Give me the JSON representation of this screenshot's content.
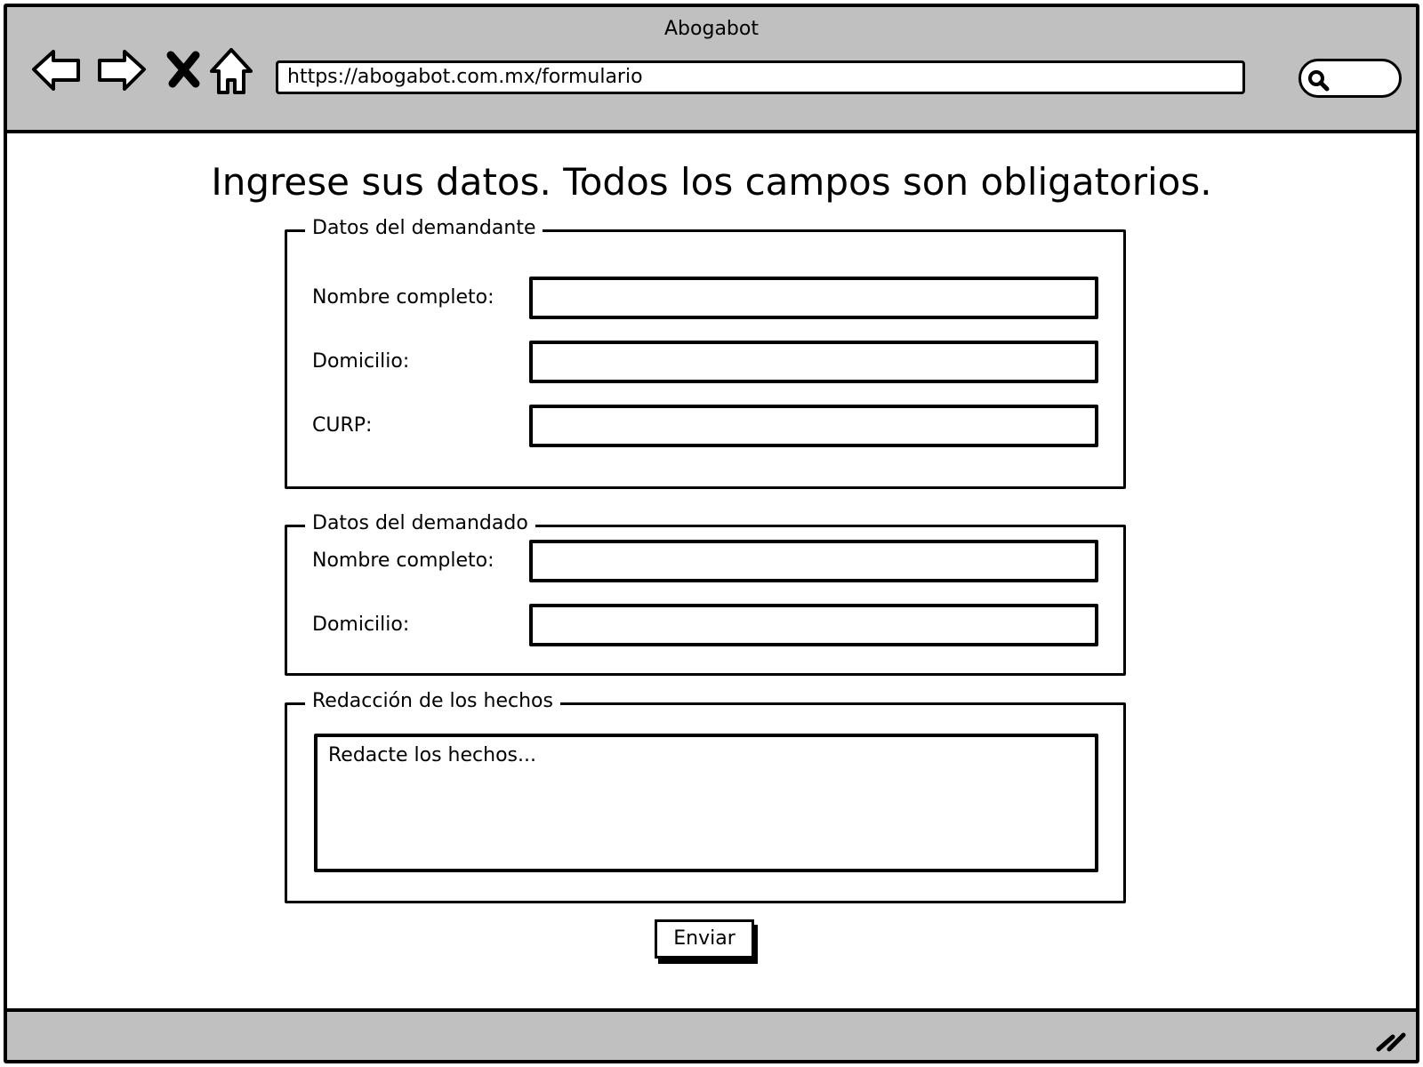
{
  "window": {
    "title": "Abogabot"
  },
  "browser": {
    "url": "https://abogabot.com.mx/formulario",
    "icons": [
      "back-arrow-icon",
      "forward-arrow-icon",
      "close-x-icon",
      "home-icon",
      "search-icon",
      "resize-grip-icon"
    ]
  },
  "page": {
    "heading": "Ingrese sus datos. Todos los campos son obligatorios.",
    "demandante": {
      "legend": "Datos del demandante",
      "nombre_label": "Nombre completo:",
      "nombre_value": "",
      "domicilio_label": "Domicilio:",
      "domicilio_value": "",
      "curp_label": "CURP:",
      "curp_value": ""
    },
    "demandado": {
      "legend": "Datos del demandado",
      "nombre_label": "Nombre completo:",
      "nombre_value": "",
      "domicilio_label": "Domicilio:",
      "domicilio_value": ""
    },
    "hechos": {
      "legend": "Redacción de los hechos",
      "placeholder": "Redacte los hechos..."
    },
    "submit_label": "Enviar"
  }
}
